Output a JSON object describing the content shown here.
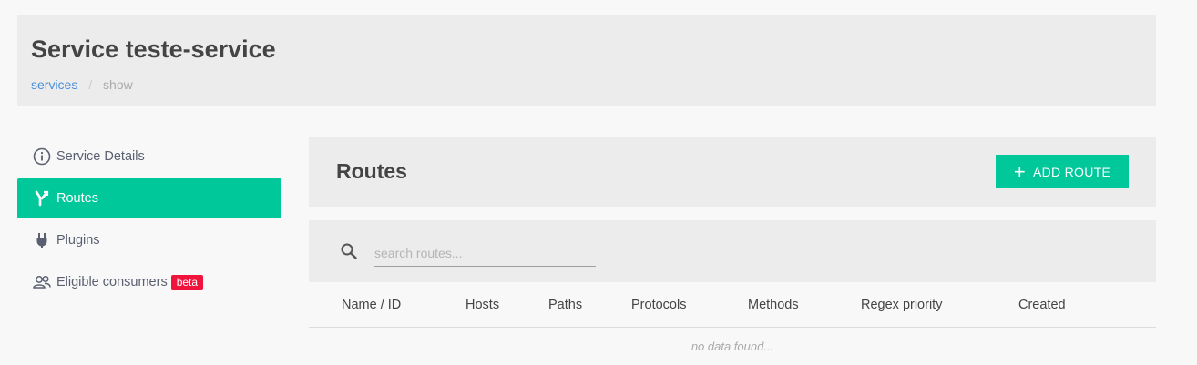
{
  "header": {
    "title": "Service teste-service",
    "breadcrumb": {
      "link": "services",
      "separator": "/",
      "current": "show"
    }
  },
  "sidebar": {
    "items": [
      {
        "label": "Service Details",
        "icon": "info-icon"
      },
      {
        "label": "Routes",
        "icon": "route-icon",
        "active": true
      },
      {
        "label": "Plugins",
        "icon": "plug-icon"
      },
      {
        "label": "Eligible consumers",
        "icon": "users-icon",
        "badge": "beta"
      }
    ]
  },
  "routes": {
    "title": "Routes",
    "add_button": "ADD ROUTE",
    "search_placeholder": "search routes...",
    "columns": [
      "Name / ID",
      "Hosts",
      "Paths",
      "Protocols",
      "Methods",
      "Regex priority",
      "Created"
    ],
    "empty_text": "no data found..."
  },
  "colors": {
    "accent": "#00c89b",
    "badge": "#f0143c",
    "link": "#4a8fd6"
  }
}
